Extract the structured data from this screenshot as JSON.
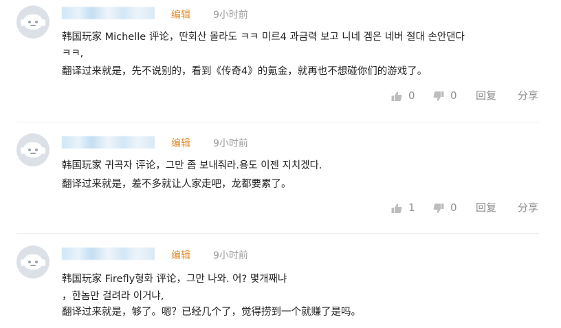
{
  "comments": [
    {
      "edit_label": "编辑",
      "time": "9小时前",
      "lines": [
        "韩国玩家 Michelle 评论，딴회산 몰라도 ㅋㅋ 미르4 과금력 보고 니네 겜은 네버 절대 손안댄다",
        "ㅋㅋ,",
        "翻译过来就是，先不说别的，看到《传奇4》的氪金，就再也不想碰你们的游戏了。"
      ],
      "likes": "0",
      "dislikes": "0",
      "reply_label": "回复",
      "share_label": "分享"
    },
    {
      "edit_label": "编辑",
      "time": "9小时前",
      "lines": [
        "韩国玩家 귀곡자 评论，그만 좀 보내줘라.용도 이젠 지치겠다.",
        "翻译过来就是，差不多就让人家走吧，龙都要累了。"
      ],
      "likes": "1",
      "dislikes": "0",
      "reply_label": "回复",
      "share_label": "分享"
    },
    {
      "edit_label": "编辑",
      "time": "9小时前",
      "lines": [
        "韩国玩家 Firefly형화 评论，그만 나와. 어? 몇개째냐",
        "，한놈만 걸려라 이거냐,",
        "翻译过来就是，够了。嗯？已经几个了，觉得捞到一个就赚了是吗。"
      ]
    }
  ]
}
